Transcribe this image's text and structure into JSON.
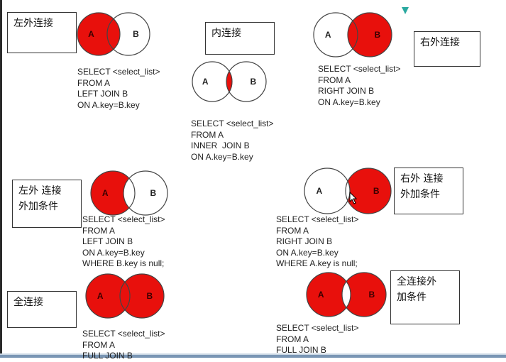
{
  "colors": {
    "fill": "#e8100c",
    "stroke": "#444444",
    "text": "#222222",
    "accent_teal": "#2aa9a0"
  },
  "panels": [
    {
      "id": "left-outer",
      "title": "左外连接",
      "circle_a": "A",
      "circle_b": "B",
      "highlight": [
        "a_only",
        "both"
      ],
      "sql": [
        "SELECT <select_list>",
        "FROM A",
        "LEFT JOIN B",
        "ON A.key=B.key"
      ]
    },
    {
      "id": "inner",
      "title": "内连接",
      "circle_a": "A",
      "circle_b": "B",
      "highlight": [
        "both"
      ],
      "sql": [
        "SELECT <select_list>",
        "FROM A",
        "INNER  JOIN B",
        "ON A.key=B.key"
      ]
    },
    {
      "id": "right-outer",
      "title": "右外连接",
      "circle_a": "A",
      "circle_b": "B",
      "highlight": [
        "b_only",
        "both"
      ],
      "sql": [
        "SELECT <select_list>",
        "FROM A",
        "RIGHT JOIN B",
        "ON A.key=B.key"
      ]
    },
    {
      "id": "left-outer-cond",
      "title": "左外 连接 外加条件",
      "circle_a": "A",
      "circle_b": "B",
      "highlight": [
        "a_only"
      ],
      "sql": [
        "SELECT <select_list>",
        "FROM A",
        "LEFT JOIN B",
        "ON A.key=B.key",
        "WHERE B.key is null;"
      ]
    },
    {
      "id": "right-outer-cond",
      "title": "右外 连接 外加条件",
      "circle_a": "A",
      "circle_b": "B",
      "highlight": [
        "b_only"
      ],
      "sql": [
        "SELECT <select_list>",
        "FROM A",
        "RIGHT JOIN B",
        "ON A.key=B.key",
        "WHERE A.key is null;"
      ]
    },
    {
      "id": "full-outer",
      "title": "全连接",
      "circle_a": "A",
      "circle_b": "B",
      "highlight": [
        "a_only",
        "both",
        "b_only"
      ],
      "sql": [
        "SELECT <select_list>",
        "FROM A",
        "FULL JOIN B"
      ]
    },
    {
      "id": "full-outer-cond",
      "title": "全连接外 加条件",
      "circle_a": "A",
      "circle_b": "B",
      "highlight": [
        "a_only",
        "b_only"
      ],
      "sql": [
        "SELECT <select_list>",
        "FROM A",
        "FULL JOIN B"
      ]
    }
  ]
}
